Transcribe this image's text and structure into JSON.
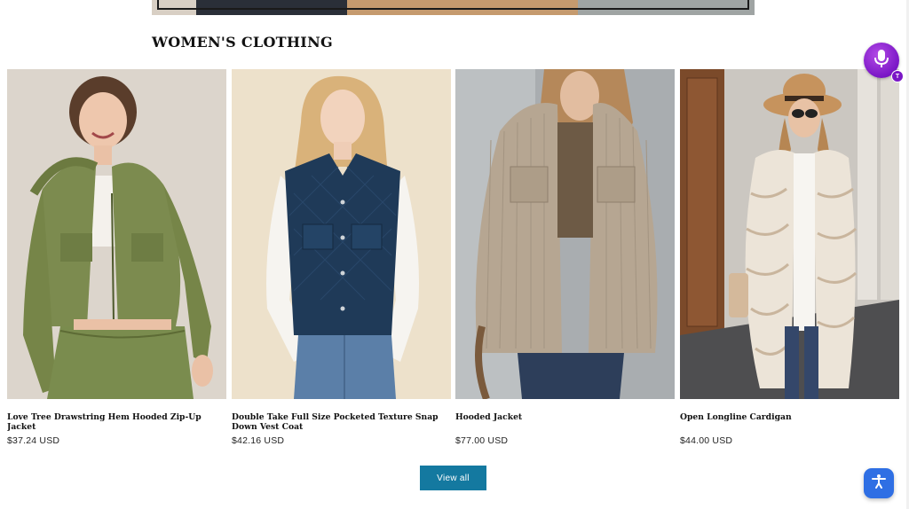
{
  "section": {
    "title": "WOMEN'S CLOTHING"
  },
  "products": [
    {
      "title": "Love Tree Drawstring Hem Hooded Zip-Up Jacket",
      "price": "$37.24 USD",
      "image": "olive-hooded-jacket-photo"
    },
    {
      "title": "Double Take Full Size Pocketed Texture Snap Down Vest Coat",
      "price": "$42.16 USD",
      "image": "navy-quilted-vest-photo"
    },
    {
      "title": "Hooded Jacket",
      "price": "$77.00 USD",
      "image": "corduroy-hooded-jacket-photo"
    },
    {
      "title": "Open Longline Cardigan",
      "price": "$44.00 USD",
      "image": "zebra-longline-cardigan-photo"
    }
  ],
  "view_all": {
    "label": "View all"
  },
  "widgets": {
    "mic_badge": "T",
    "mic_icon": "microphone-icon",
    "accessibility_icon": "accessibility-icon"
  },
  "colors": {
    "button": "#1479a0",
    "mic": "#7a16c6",
    "accessibility": "#2f6fe4"
  }
}
